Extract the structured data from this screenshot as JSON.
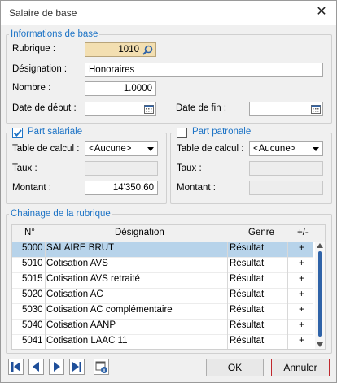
{
  "window": {
    "title": "Salaire de base",
    "close_glyph": "✕"
  },
  "info": {
    "legend": "Informations de base",
    "rubrique_label": "Rubrique :",
    "rubrique_value": "1010",
    "designation_label": "Désignation :",
    "designation_value": "Honoraires",
    "nombre_label": "Nombre :",
    "nombre_value": "1.0000",
    "date_debut_label": "Date de début :",
    "date_fin_label": "Date de fin :"
  },
  "salariale": {
    "legend": "Part salariale",
    "checked": true,
    "table_label": "Table de calcul :",
    "table_value": "<Aucune>",
    "taux_label": "Taux :",
    "montant_label": "Montant :",
    "montant_value": "14'350.60"
  },
  "patronale": {
    "legend": "Part patronale",
    "checked": false,
    "table_label": "Table de calcul :",
    "table_value": "<Aucune>",
    "taux_label": "Taux :",
    "montant_label": "Montant :"
  },
  "chainage": {
    "legend": "Chainage de la rubrique",
    "headers": {
      "no": "N°",
      "designation": "Désignation",
      "genre": "Genre",
      "plusminus": "+/-"
    },
    "rows": [
      {
        "no": "5000",
        "designation": "SALAIRE BRUT",
        "genre": "Résultat",
        "sign": "+"
      },
      {
        "no": "5010",
        "designation": "Cotisation AVS",
        "genre": "Résultat",
        "sign": "+"
      },
      {
        "no": "5015",
        "designation": "Cotisation AVS retraité",
        "genre": "Résultat",
        "sign": "+"
      },
      {
        "no": "5020",
        "designation": "Cotisation AC",
        "genre": "Résultat",
        "sign": "+"
      },
      {
        "no": "5030",
        "designation": "Cotisation AC complémentaire",
        "genre": "Résultat",
        "sign": "+"
      },
      {
        "no": "5040",
        "designation": "Cotisation AANP",
        "genre": "Résultat",
        "sign": "+"
      },
      {
        "no": "5041",
        "designation": "Cotisation LAAC 11",
        "genre": "Résultat",
        "sign": "+"
      }
    ]
  },
  "footer": {
    "ok_label": "OK",
    "cancel_label": "Annuler"
  },
  "colors": {
    "accent": "#1e74c6",
    "selected_row": "#b7d3ea",
    "rubrique_bg": "#f3dfb1",
    "nav_blue": "#1f4f9a",
    "cancel_border": "#c0282d"
  }
}
